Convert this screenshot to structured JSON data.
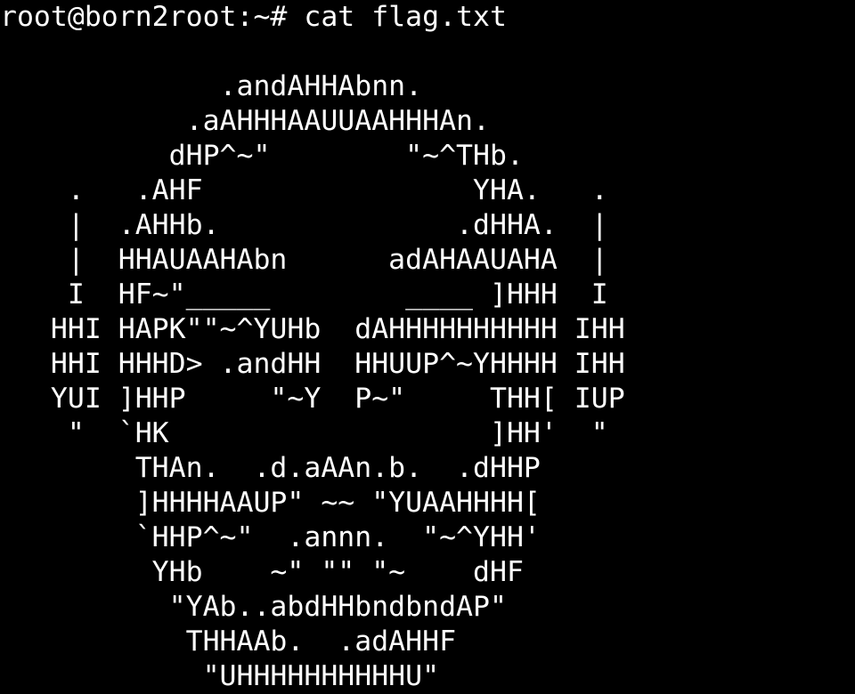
{
  "terminal": {
    "background": "#000000",
    "foreground": "#ffffff",
    "prompt": "root@born2root:~# ",
    "command": "cat flag.txt",
    "output_lines": [
      "",
      "             .andAHHAbnn.",
      "           .aAHHHAAUUAAHHHAn.",
      "          dHP^~\"        \"~^THb.",
      "    .   .AHF                YHA.   .",
      "    |  .AHHb.              .dHHA.  |",
      "    |  HHAUAAHAbn      adAHAAUAHA  |",
      "    I  HF~\"_____        ____ ]HHH  I",
      "   HHI HAPK\"\"~^YUHb  dAHHHHHHHHHH IHH",
      "   HHI HHHD> .andHH  HHUUP^~YHHHH IHH",
      "   YUI ]HHP     \"~Y  P~\"     THH[ IUP",
      "    \"  `HK                   ]HH'  \"",
      "        THAn.  .d.aAAn.b.  .dHHP",
      "        ]HHHHAAUP\" ~~ \"YUAAHHHH[",
      "        `HHP^~\"  .annn.  \"~^YHH'",
      "         YHb    ~\" \"\" \"~    dHF",
      "          \"YAb..abdHHbndbndAP\"",
      "           THHAAb.  .adAHHF",
      "            \"UHHHHHHHHHHU\""
    ]
  }
}
